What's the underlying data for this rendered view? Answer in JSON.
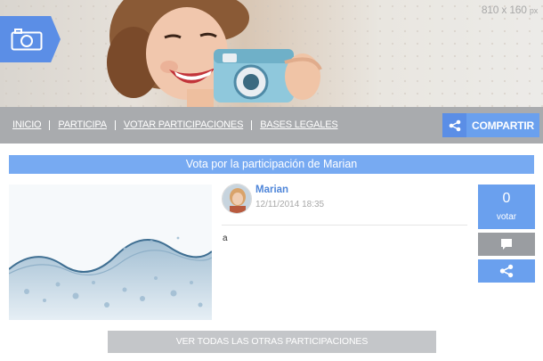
{
  "banner": {
    "size_label": "810 x 160",
    "size_unit": "px",
    "camera_icon": "camera-icon"
  },
  "nav": {
    "links": [
      "INICIO",
      "PARTICIPA",
      "VOTAR PARTICIPACIONES",
      "BASES LEGALES"
    ],
    "share_label": "COMPARTIR",
    "share_icon": "share-icon"
  },
  "main": {
    "title": "Vota por la participación de Marian",
    "author": "Marian",
    "date": "12/11/2014 18:35",
    "text": "a",
    "votes": "0",
    "vote_label": "votar",
    "comment_icon": "comment-icon",
    "share_icon": "share-icon"
  },
  "footer": {
    "all_entries_label": "VER TODAS LAS OTRAS PARTICIPACIONES"
  },
  "colors": {
    "accent": "#6aa0ee",
    "accent_dark": "#5b8ee6",
    "nav_bg": "#a9abae",
    "title_bg": "#77aaf2",
    "author": "#4f86d9",
    "button_gray": "#c4c6c9"
  }
}
